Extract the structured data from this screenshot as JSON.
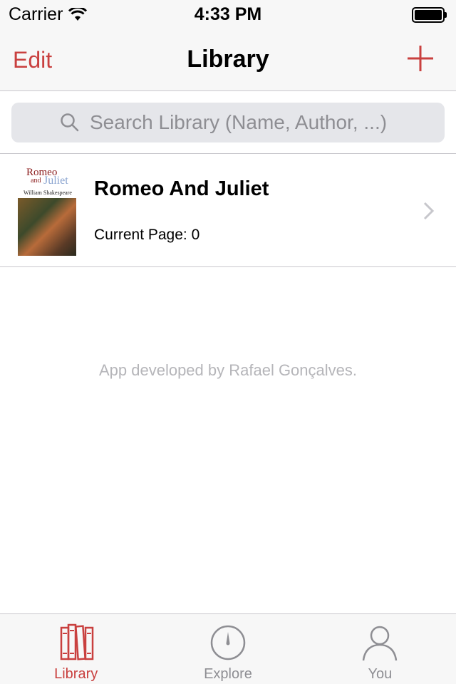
{
  "status_bar": {
    "carrier": "Carrier",
    "time": "4:33 PM"
  },
  "nav": {
    "edit_label": "Edit",
    "title": "Library",
    "add_icon": "plus-icon"
  },
  "search": {
    "placeholder": "Search Library (Name, Author, ...)"
  },
  "books": [
    {
      "title": "Romeo And Juliet",
      "current_page_text": "Current Page: 0",
      "cover": {
        "title_line1": "Romeo",
        "title_line2": "and",
        "title_line3": "Juliet",
        "author": "William Shakespeare"
      }
    }
  ],
  "footer_credit": "App developed by Rafael Gonçalves.",
  "tabs": [
    {
      "label": "Library",
      "icon": "books-icon",
      "active": true
    },
    {
      "label": "Explore",
      "icon": "compass-icon",
      "active": false
    },
    {
      "label": "You",
      "icon": "person-icon",
      "active": false
    }
  ],
  "colors": {
    "accent": "#c9403f",
    "inactive": "#8e8e93",
    "separator": "#c8c7cc"
  }
}
